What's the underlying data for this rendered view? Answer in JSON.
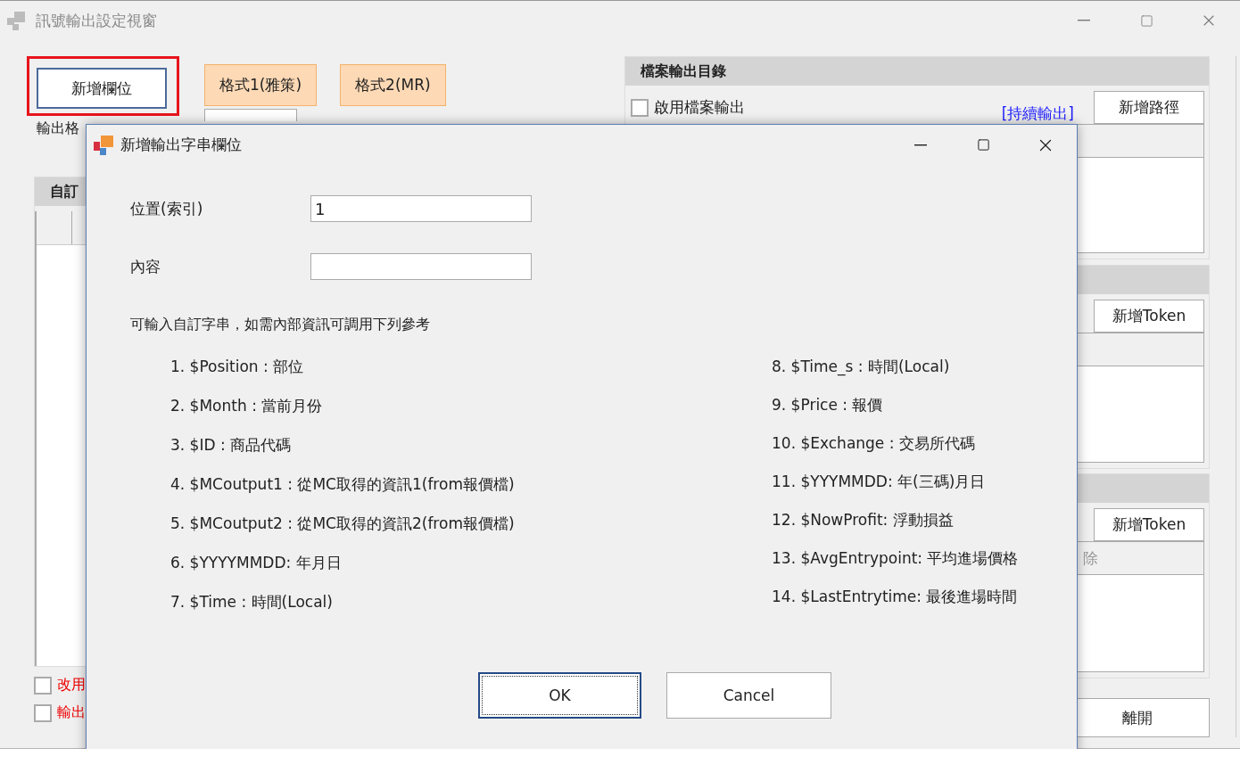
{
  "window": {
    "title": "訊號輸出設定視窗"
  },
  "toolbar": {
    "add_button": {
      "label": "新增欄位",
      "highlighted": true
    },
    "format_buttons": [
      "格式1(雅策)",
      "格式2(MR)"
    ]
  },
  "count_label": "輸出格",
  "custom_group": {
    "title": "自訂"
  },
  "options": [
    {
      "label": "改用",
      "checked": false
    },
    {
      "label": "輸出",
      "checked": false
    }
  ],
  "file_output": {
    "title": "檔案輸出目錄",
    "enable": {
      "label": "啟用檔案輸出",
      "checked": false
    },
    "link": "[持續輸出]",
    "add_button": "新增路徑"
  },
  "token_panels": [
    {
      "add_button": "新增Token"
    },
    {
      "add_button": "新增Token",
      "column": "除"
    }
  ],
  "exit_button": "離開",
  "dialog": {
    "title": "新增輸出字串欄位",
    "fields": [
      {
        "label": "位置(索引)",
        "value": "1"
      },
      {
        "label": "內容"
      }
    ],
    "note": "可輸入自訂字串，如需內部資訊可調用下列參考",
    "left_items": [
      "1. $Position : 部位",
      "2. $Month : 當前月份",
      "3. $ID : 商品代碼",
      "4. $MCoutput1 : 從MC取得的資訊1(from報價檔)",
      "5. $MCoutput2 : 從MC取得的資訊2(from報價檔)",
      "6. $YYYYMMDD: 年月日",
      "7. $Time : 時間(Local)"
    ],
    "right_items": [
      "8. $Time_s : 時間(Local)",
      "9. $Price : 報價",
      "10. $Exchange : 交易所代碼",
      "11. $YYYMMDD: 年(三碼)月日",
      "12. $NowProfit: 浮動損益",
      "13. $AvgEntrypoint: 平均進場價格",
      "14. $LastEntrytime: 最後進場時間"
    ],
    "buttons": [
      {
        "label": "OK",
        "default": true
      },
      {
        "label": "Cancel",
        "default": false
      }
    ]
  }
}
